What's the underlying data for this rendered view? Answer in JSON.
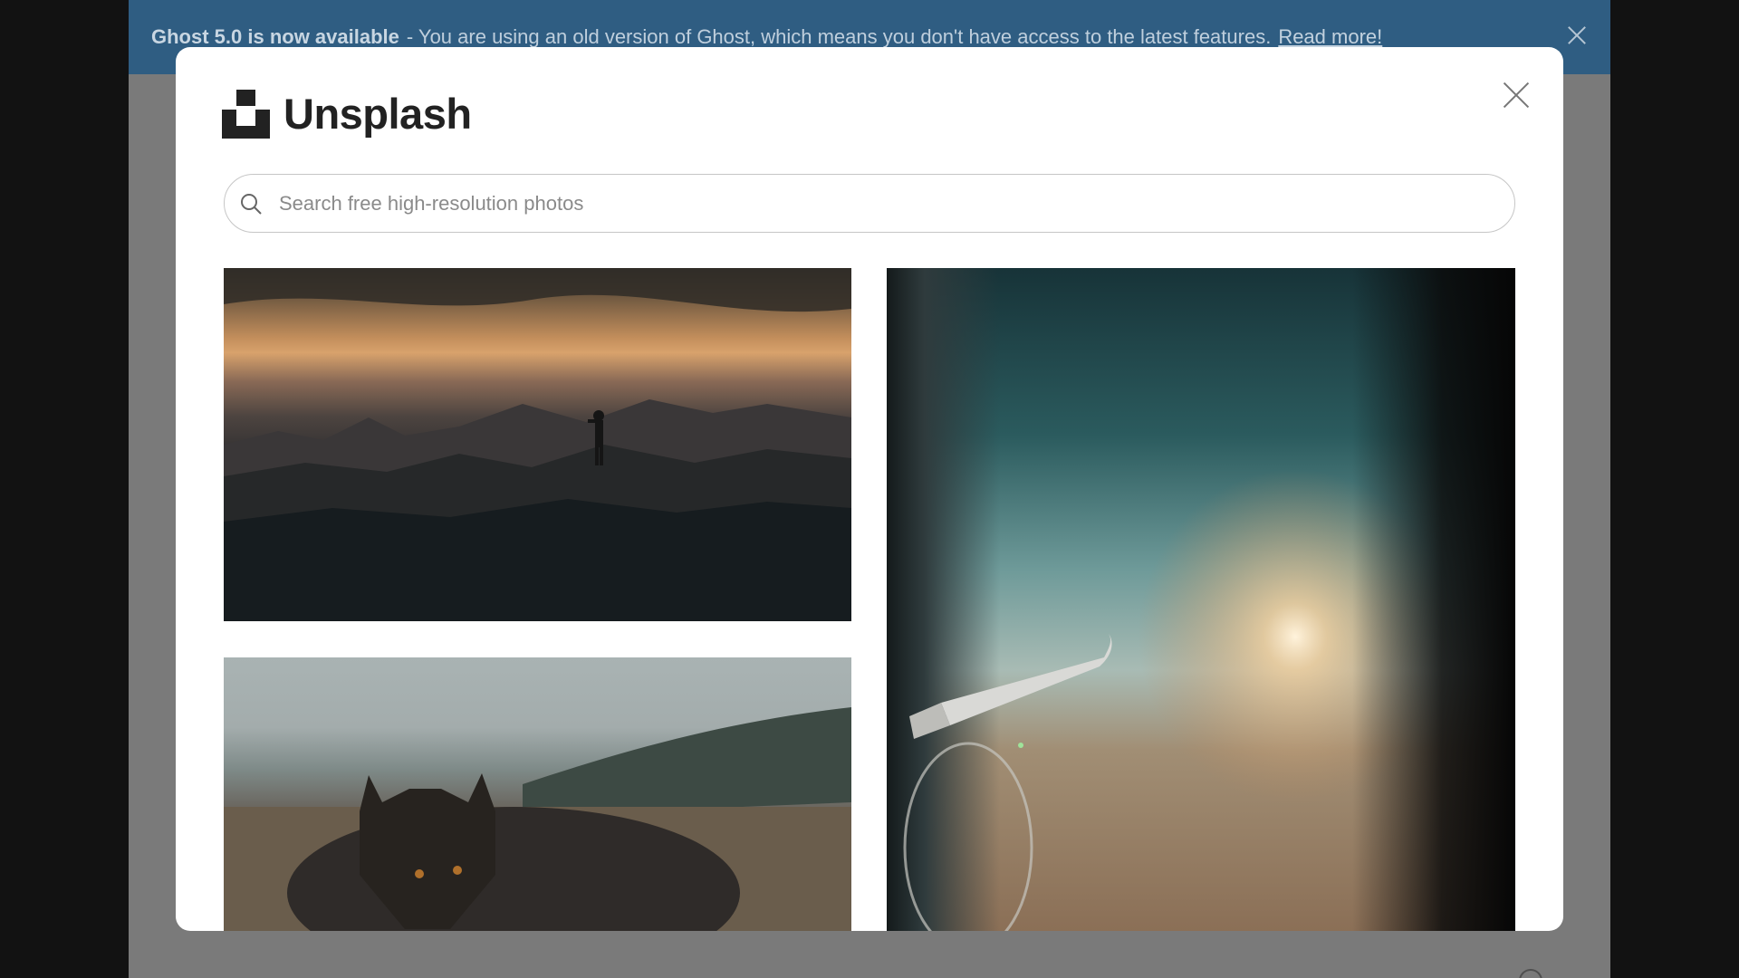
{
  "banner": {
    "title": "Ghost 5.0 is now available",
    "message": "- You are using an old version of Ghost, which means you don't have access to the latest features.",
    "link": "Read more!"
  },
  "modal": {
    "brand": "Unsplash",
    "search": {
      "placeholder": "Search free high-resolution photos",
      "value": ""
    },
    "photos": [
      {
        "icon": "photo-mountain-sunset-silhouette"
      },
      {
        "icon": "photo-arctic-fox"
      },
      {
        "icon": "photo-airplane-wing-sunset"
      }
    ]
  },
  "icons": {
    "banner_close": "close-icon",
    "modal_close": "close-icon",
    "search": "search-icon",
    "logo": "unsplash-logo-icon"
  },
  "colors": {
    "banner_bg": "#2f5d82",
    "overlay": "#7a7a7a",
    "modal_bg": "#ffffff"
  }
}
